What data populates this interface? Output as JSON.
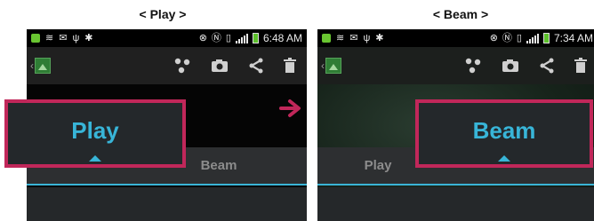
{
  "captions": {
    "left": "< Play >",
    "right": "< Beam >"
  },
  "left_screen": {
    "status": {
      "time": "6:48 AM"
    },
    "tabs": {
      "selected": "Play",
      "other": "Beam"
    },
    "actions": [
      "share-connect-icon",
      "camera-icon",
      "share-icon",
      "trash-icon"
    ]
  },
  "right_screen": {
    "status": {
      "time": "7:34 AM"
    },
    "tabs": {
      "selected": "Beam",
      "other": "Play"
    },
    "actions": [
      "share-connect-icon",
      "camera-icon",
      "share-icon",
      "trash-icon"
    ]
  },
  "colors": {
    "highlight_border": "#c1275a",
    "selected_tab_text": "#38b5d8",
    "arrow": "#c1275a",
    "tab_underline": "#3ab4d6"
  }
}
